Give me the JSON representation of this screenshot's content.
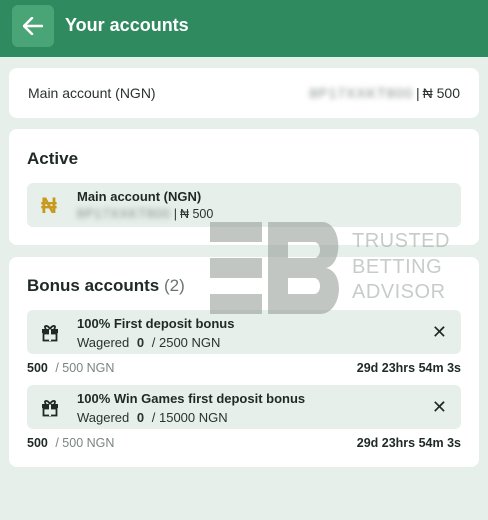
{
  "header": {
    "title": "Your accounts"
  },
  "main_account": {
    "label": "Main account (NGN)",
    "masked_id": "8P17XXKT800",
    "separator": "|",
    "amount": "₦ 500"
  },
  "active": {
    "title": "Active",
    "account": {
      "name": "Main account (NGN)",
      "masked_id": "8P17XXKT800",
      "separator": "|",
      "amount": "₦ 500",
      "icon_glyph": "₦"
    }
  },
  "bonus": {
    "title": "Bonus accounts",
    "count": "(2)",
    "items": [
      {
        "name": "100% First deposit bonus",
        "wagered_label": "Wagered",
        "wagered_value": "0",
        "wagered_total": "/ 2500 NGN",
        "balance": "500",
        "balance_total": "/ 500 NGN",
        "time_left": "29d 23hrs 54m 3s"
      },
      {
        "name": "100% Win Games first deposit bonus",
        "wagered_label": "Wagered",
        "wagered_value": "0",
        "wagered_total": "/ 15000 NGN",
        "balance": "500",
        "balance_total": "/ 500 NGN",
        "time_left": "29d 23hrs 54m 3s"
      }
    ]
  },
  "watermark": {
    "line1": "TRUSTED",
    "line2": "BETTING",
    "line3": "ADVISOR"
  },
  "colors": {
    "brand_green": "#2f8a5f",
    "naira_gold": "#c79a1d",
    "background": "#e6efea"
  }
}
